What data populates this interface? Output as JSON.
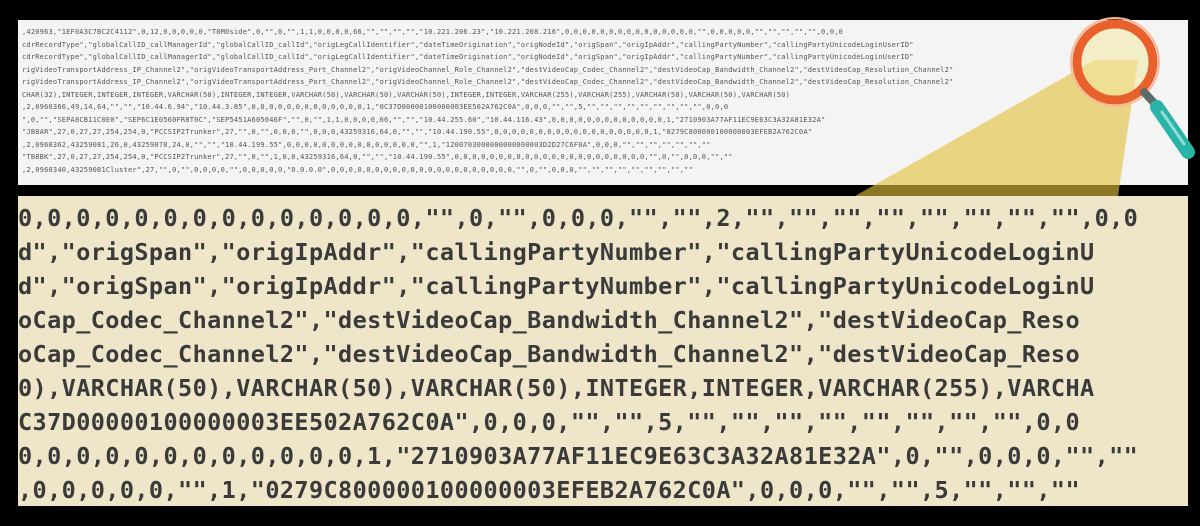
{
  "top_strip": {
    "lines": [
      ",420963,\"1EF0A3C7BC2C4112\",0,12,0,0,0,0,0,\"T0M0side\",0,\"\",0,\"\",1,1,0,0,0,0,66,\"\",\"\",\"\",\"\",\"10.221.206.23\",\"10.221.208.216\",0,0,0,0,0,0,0,0,0,0,0,0,0,0,0,\"\",0,0,0,0,0,\"\",\"\",\"\",\"\",\"\",0,0,0",
      "cdrRecordType\",\"globalCallID_callManagerId\",\"globalCallID_callId\",\"origLegCallIdentifier\",\"dateTimeOrigination\",\"origNodeId\",\"origSpan\",\"origIpAddr\",\"callingPartyNumber\",\"callingPartyUnicodeLoginUserID\"",
      "cdrRecordType\",\"globalCallID_callManagerId\",\"globalCallID_callId\",\"origLegCallIdentifier\",\"dateTimeOrigination\",\"origNodeId\",\"origSpan\",\"origIpAddr\",\"callingPartyNumber\",\"callingPartyUnicodeLoginUserID\"",
      "rigVideoTransportAddress_IP_Channel2\",\"origVideoTransportAddress_Port_Channel2\",\"origVideoChannel_Role_Channel2\",\"destVideoCap_Codec_Channel2\",\"destVideoCap_Bandwidth_Channel2\",\"destVideoCap_Resolution_Channel2\"",
      "rigVideoTransportAddress_IP_Channel2\",\"origVideoTransportAddress_Port_Channel2\",\"origVideoChannel_Role_Channel2\",\"destVideoCap_Codec_Channel2\",\"destVideoCap_Bandwidth_Channel2\",\"destVideoCap_Resolution_Channel2\"",
      "CHAR(32),INTEGER,INTEGER,INTEGER,VARCHAR(50),INTEGER,INTEGER,VARCHAR(50),VARCHAR(50),VARCHAR(50),INTEGER,INTEGER,VARCHAR(255),VARCHAR(255),VARCHAR(50),VARCHAR(50),VARCHAR(50)",
      ",2,0960366,49,14,64,\"\",\"\",\"10.44.6.94\",\"10.44.3.85\",0,0,0,0,0,0,0,0,0,0,0,0,0,1,\"0C37D00000100000003EE502A762C0A\",0,0,0,\"\",\"\",5,\"\",\"\",\"\",\"\",\"\",\"\",\"\",\"\",\"\",0,0,0",
      "\",0,\"\",\"SEPA8CB11C0E0\",\"SEP6C1E0560FR8T0C\",\"SEP5451A605046F\",\"\",0,\"\",1,1,0,0,0,0,66,\"\",\"\",\"10.44.255.60\",\"10.44.116.43\",0,0,0,0,0,0,0,0,0,0,0,0,0,1,\"2710903A77AF11EC9E63C3A32A81E32A\"",
      "\"JB8AR\",27,0,27,27,254,254,0,\"PCCSIP2Trunker\",27,\"\",0,\"\",0,0,0,\"\",0,0,0,43259316,64,0,\"\",\"\",\"10.44.190.55\",0,0,0,0,0,0,0,0,0,0,0,0,0,0,0,0,0,0,1,\"0279C800000100000003EFEB2A762C0A\"",
      ",2,0960362,43259081,26,0,43259078,24,0,\"\",\"\",\"10.44.199.55\",0,0,0,0,0,0,0,0,0,0,0,0,0,0,0,\"\",1,\"1200703000000000000003D2D27C6F0A\",0,0,0,\"\",\"\",\"\",\"\",\"\",\"\",\"\"",
      "\"TB8BK\",27,0,27,27,254,254,0,\"PCCSIP2Trunker\",27,\"\",0,\"\",1,0,0,43259316,64,0,\"\",\"\",\"10.44.190.55\",0,0,0,0,0,0,0,0,0,0,0,0,0,0,0,0,0,0,0,0,0,0,\"\",0,\"\",0,0,0,\"\",\"\"",
      ",2,0960340,43259081Cluster\",27,\"\",0,\"\",0,0,0,0,\"\",0,0,0,0,0,\"0.0.0.0\",0,0,0,0,0,0,0,0,0,0,0,0,0,0,0,0,0,0,0,0,0,\"\",0,\"\",0,0,0,\"\",\"\",\"\",\"\",\"\",\"\",\"\",\"\",\"\""
    ]
  },
  "zoom_panel": {
    "lines": [
      "0,0,0,0,0,0,0,0,0,0,0,0,0,0,\"\",0,\"\",0,0,0,\"\",\"\",2,\"\",\"\",\"\",\"\",\"\",\"\",\"\",\"\",0,0",
      "d\",\"origSpan\",\"origIpAddr\",\"callingPartyNumber\",\"callingPartyUnicodeLoginU",
      "d\",\"origSpan\",\"origIpAddr\",\"callingPartyNumber\",\"callingPartyUnicodeLoginU",
      "oCap_Codec_Channel2\",\"destVideoCap_Bandwidth_Channel2\",\"destVideoCap_Reso",
      "oCap_Codec_Channel2\",\"destVideoCap_Bandwidth_Channel2\",\"destVideoCap_Reso",
      "0),VARCHAR(50),VARCHAR(50),VARCHAR(50),INTEGER,INTEGER,VARCHAR(255),VARCHA",
      "C37D00000100000003EE502A762C0A\",0,0,0,\"\",\"\",5,\"\",\"\",\"\",\"\",\"\",\"\",\"\",\"\",0,0",
      "0,0,0,0,0,0,0,0,0,0,0,0,1,\"2710903A77AF11EC9E63C3A32A81E32A\",0,\"\",0,0,0,\"\",\"\"",
      ",0,0,0,0,0,\"\",1,\"0279C800000100000003EFEB2A762C0A\",0,0,0,\"\",\"\",5,\"\",\"\",\"\""
    ]
  },
  "colors": {
    "background": "#000000",
    "strip_bg": "#f4f4f4",
    "zoom_bg": "#efe5c8",
    "beam": "#e2c23a",
    "lens_ring": "#e8612c",
    "handle": "#2bb3a8"
  },
  "icons": {
    "magnifier": "magnifying-glass-icon"
  }
}
